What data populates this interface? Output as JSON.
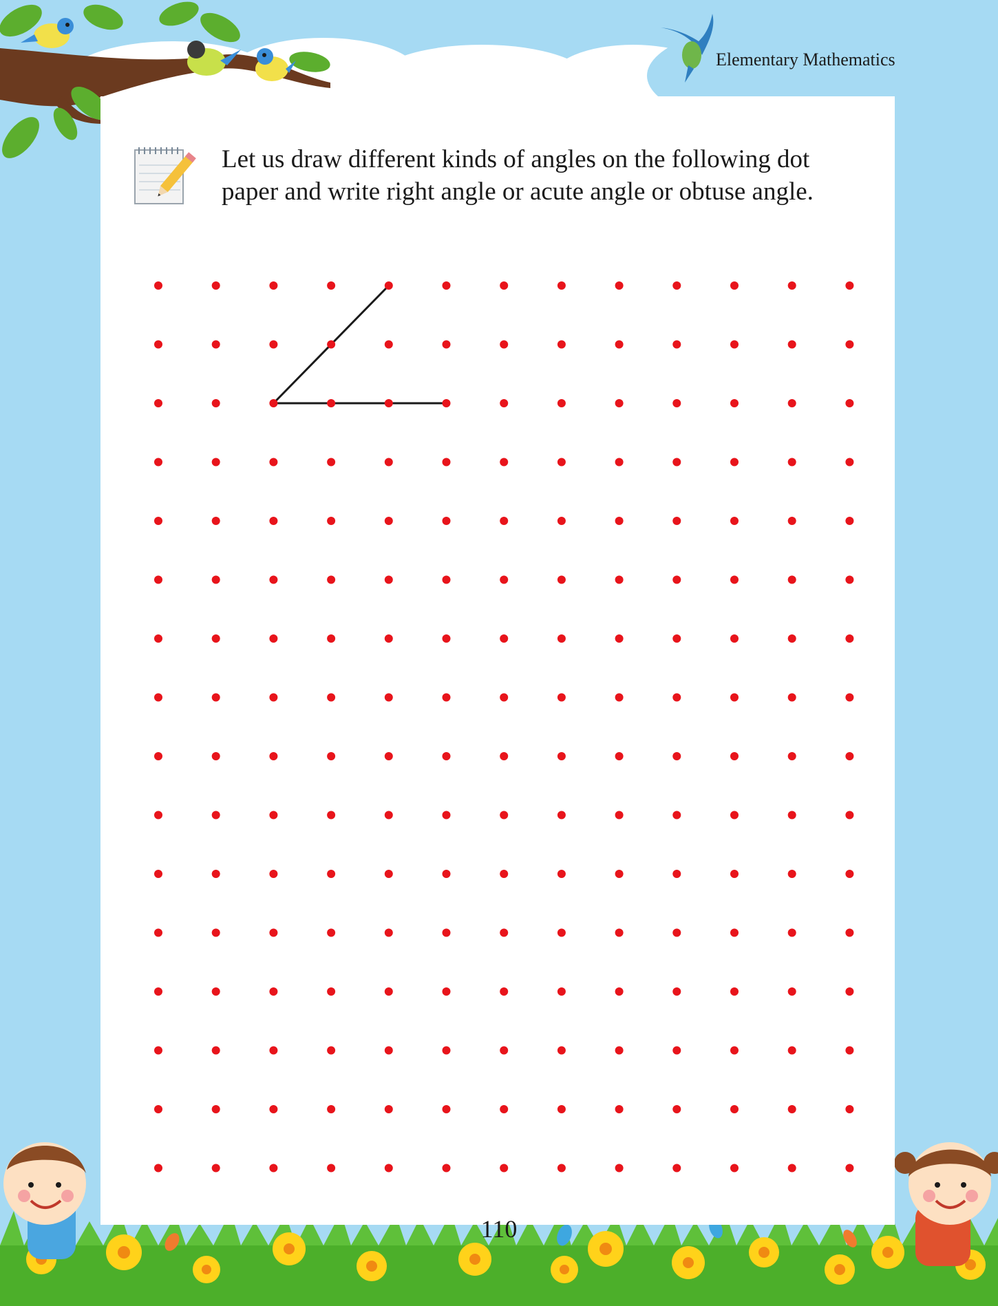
{
  "header": {
    "subject": "Elementary Mathematics"
  },
  "instruction": {
    "line1": "Let us draw different kinds of angles on the following dot",
    "line2": "paper and write right angle or acute angle or obtuse angle."
  },
  "dot_grid": {
    "rows": 16,
    "cols": 13,
    "dot_color": "#e8141b",
    "example_angle": {
      "vertex": [
        2,
        2
      ],
      "arm1_end": [
        4,
        0
      ],
      "arm2_end": [
        5,
        2
      ],
      "line_color": "#1a1a1a"
    }
  },
  "page_number": "110",
  "colors": {
    "sky": "#a6daf3",
    "paper": "#ffffff",
    "grass": "#4caf2a",
    "flower": "#ffd21a"
  }
}
